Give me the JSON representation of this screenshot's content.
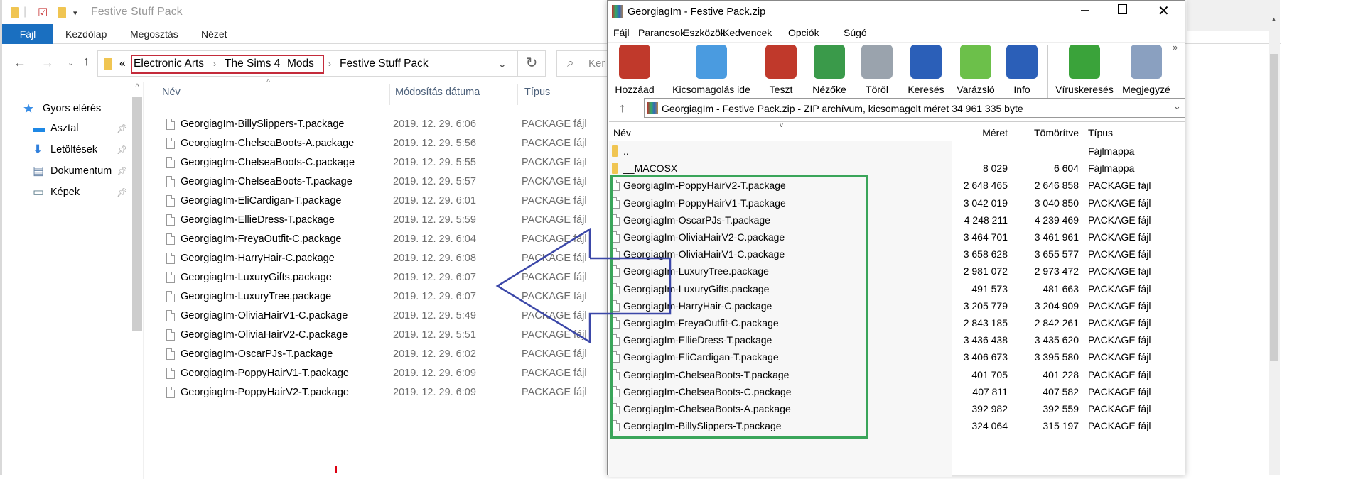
{
  "explorer": {
    "title": "Festive Stuff Pack",
    "ribbon_tabs": [
      "Fájl",
      "Kezdőlap",
      "Megosztás",
      "Nézet"
    ],
    "breadcrumb": [
      "Electronic Arts",
      "The Sims 4",
      "Mods",
      "Festive Stuff Pack"
    ],
    "breadcrumb_overflow": "«",
    "search_placeholder": "Ker",
    "columns": [
      "Név",
      "Módosítás dátuma",
      "Típus"
    ],
    "sidebar": {
      "quick_access": "Gyors elérés",
      "items": [
        "Asztal",
        "Letöltések",
        "Dokumentum",
        "Képek"
      ]
    },
    "files": [
      [
        "GeorgiagIm-BillySlippers-T.package",
        "2019. 12. 29. 6:06",
        "PACKAGE fájl"
      ],
      [
        "GeorgiagIm-ChelseaBoots-A.package",
        "2019. 12. 29. 5:56",
        "PACKAGE fájl"
      ],
      [
        "GeorgiagIm-ChelseaBoots-C.package",
        "2019. 12. 29. 5:55",
        "PACKAGE fájl"
      ],
      [
        "GeorgiagIm-ChelseaBoots-T.package",
        "2019. 12. 29. 5:57",
        "PACKAGE fájl"
      ],
      [
        "GeorgiagIm-EliCardigan-T.package",
        "2019. 12. 29. 6:01",
        "PACKAGE fájl"
      ],
      [
        "GeorgiagIm-EllieDress-T.package",
        "2019. 12. 29. 5:59",
        "PACKAGE fájl"
      ],
      [
        "GeorgiagIm-FreyaOutfit-C.package",
        "2019. 12. 29. 6:04",
        "PACKAGE fájl"
      ],
      [
        "GeorgiagIm-HarryHair-C.package",
        "2019. 12. 29. 6:08",
        "PACKAGE fájl"
      ],
      [
        "GeorgiagIm-LuxuryGifts.package",
        "2019. 12. 29. 6:07",
        "PACKAGE fájl"
      ],
      [
        "GeorgiagIm-LuxuryTree.package",
        "2019. 12. 29. 6:07",
        "PACKAGE fájl"
      ],
      [
        "GeorgiagIm-OliviaHairV1-C.package",
        "2019. 12. 29. 5:49",
        "PACKAGE fájl"
      ],
      [
        "GeorgiagIm-OliviaHairV2-C.package",
        "2019. 12. 29. 5:51",
        "PACKAGE fájl"
      ],
      [
        "GeorgiagIm-OscarPJs-T.package",
        "2019. 12. 29. 6:02",
        "PACKAGE fájl"
      ],
      [
        "GeorgiagIm-PoppyHairV1-T.package",
        "2019. 12. 29. 6:09",
        "PACKAGE fájl"
      ],
      [
        "GeorgiagIm-PoppyHairV2-T.package",
        "2019. 12. 29. 6:09",
        "PACKAGE fájl"
      ]
    ]
  },
  "winrar": {
    "title": "GeorgiagIm - Festive Pack.zip",
    "menu": [
      "Fájl",
      "Parancsok",
      "Eszközök",
      "Kedvencek",
      "Opciók",
      "Súgó"
    ],
    "toolbar": [
      {
        "label": "Hozzáad",
        "icon": "add-archive-icon",
        "color": "#c0392b"
      },
      {
        "label": "Kicsomagolás ide",
        "icon": "extract-folder-icon",
        "color": "#4a9be0"
      },
      {
        "label": "Teszt",
        "icon": "test-clipboard-icon",
        "color": "#c0392b"
      },
      {
        "label": "Nézőke",
        "icon": "view-book-icon",
        "color": "#3a9a4a"
      },
      {
        "label": "Töröl",
        "icon": "trash-icon",
        "color": "#9aa3ad"
      },
      {
        "label": "Keresés",
        "icon": "magnifier-icon",
        "color": "#2b5fb8"
      },
      {
        "label": "Varázsló",
        "icon": "wizard-wand-icon",
        "color": "#6cc04a"
      },
      {
        "label": "Info",
        "icon": "info-icon",
        "color": "#2b5fb8"
      },
      {
        "label": "Víruskeresés",
        "icon": "virus-scan-icon",
        "color": "#3aa33a"
      },
      {
        "label": "Megjegyzé",
        "icon": "comment-icon",
        "color": "#8aa0c0"
      }
    ],
    "more": "»",
    "address": "GeorgiagIm - Festive Pack.zip - ZIP archívum, kicsomagolt méret 34 961 335 byte",
    "columns": [
      "Név",
      "Méret",
      "Tömörítve",
      "Típus"
    ],
    "entries": [
      [
        "..",
        "",
        "",
        "Fájlmappa"
      ],
      [
        "__MACOSX",
        "8 029",
        "6 604",
        "Fájlmappa"
      ],
      [
        "GeorgiagIm-PoppyHairV2-T.package",
        "2 648 465",
        "2 646 858",
        "PACKAGE fájl"
      ],
      [
        "GeorgiagIm-PoppyHairV1-T.package",
        "3 042 019",
        "3 040 850",
        "PACKAGE fájl"
      ],
      [
        "GeorgiagIm-OscarPJs-T.package",
        "4 248 211",
        "4 239 469",
        "PACKAGE fájl"
      ],
      [
        "GeorgiagIm-OliviaHairV2-C.package",
        "3 464 701",
        "3 461 961",
        "PACKAGE fájl"
      ],
      [
        "GeorgiagIm-OliviaHairV1-C.package",
        "3 658 628",
        "3 655 577",
        "PACKAGE fájl"
      ],
      [
        "GeorgiagIm-LuxuryTree.package",
        "2 981 072",
        "2 973 472",
        "PACKAGE fájl"
      ],
      [
        "GeorgiagIm-LuxuryGifts.package",
        "491 573",
        "481 663",
        "PACKAGE fájl"
      ],
      [
        "GeorgiagIm-HarryHair-C.package",
        "3 205 779",
        "3 204 909",
        "PACKAGE fájl"
      ],
      [
        "GeorgiagIm-FreyaOutfit-C.package",
        "2 843 185",
        "2 842 261",
        "PACKAGE fájl"
      ],
      [
        "GeorgiagIm-EllieDress-T.package",
        "3 436 438",
        "3 435 620",
        "PACKAGE fájl"
      ],
      [
        "GeorgiagIm-EliCardigan-T.package",
        "3 406 673",
        "3 395 580",
        "PACKAGE fájl"
      ],
      [
        "GeorgiagIm-ChelseaBoots-T.package",
        "401 705",
        "401 228",
        "PACKAGE fájl"
      ],
      [
        "GeorgiagIm-ChelseaBoots-C.package",
        "407 811",
        "407 582",
        "PACKAGE fájl"
      ],
      [
        "GeorgiagIm-ChelseaBoots-A.package",
        "392 982",
        "392 559",
        "PACKAGE fájl"
      ],
      [
        "GeorgiagIm-BillySlippers-T.package",
        "324 064",
        "315 197",
        "PACKAGE fájl"
      ]
    ]
  },
  "annotations": {
    "breadcrumb_highlight": "#c42b3b",
    "selection_highlight": "#3aa55a",
    "arrow": "#3b47a8"
  }
}
